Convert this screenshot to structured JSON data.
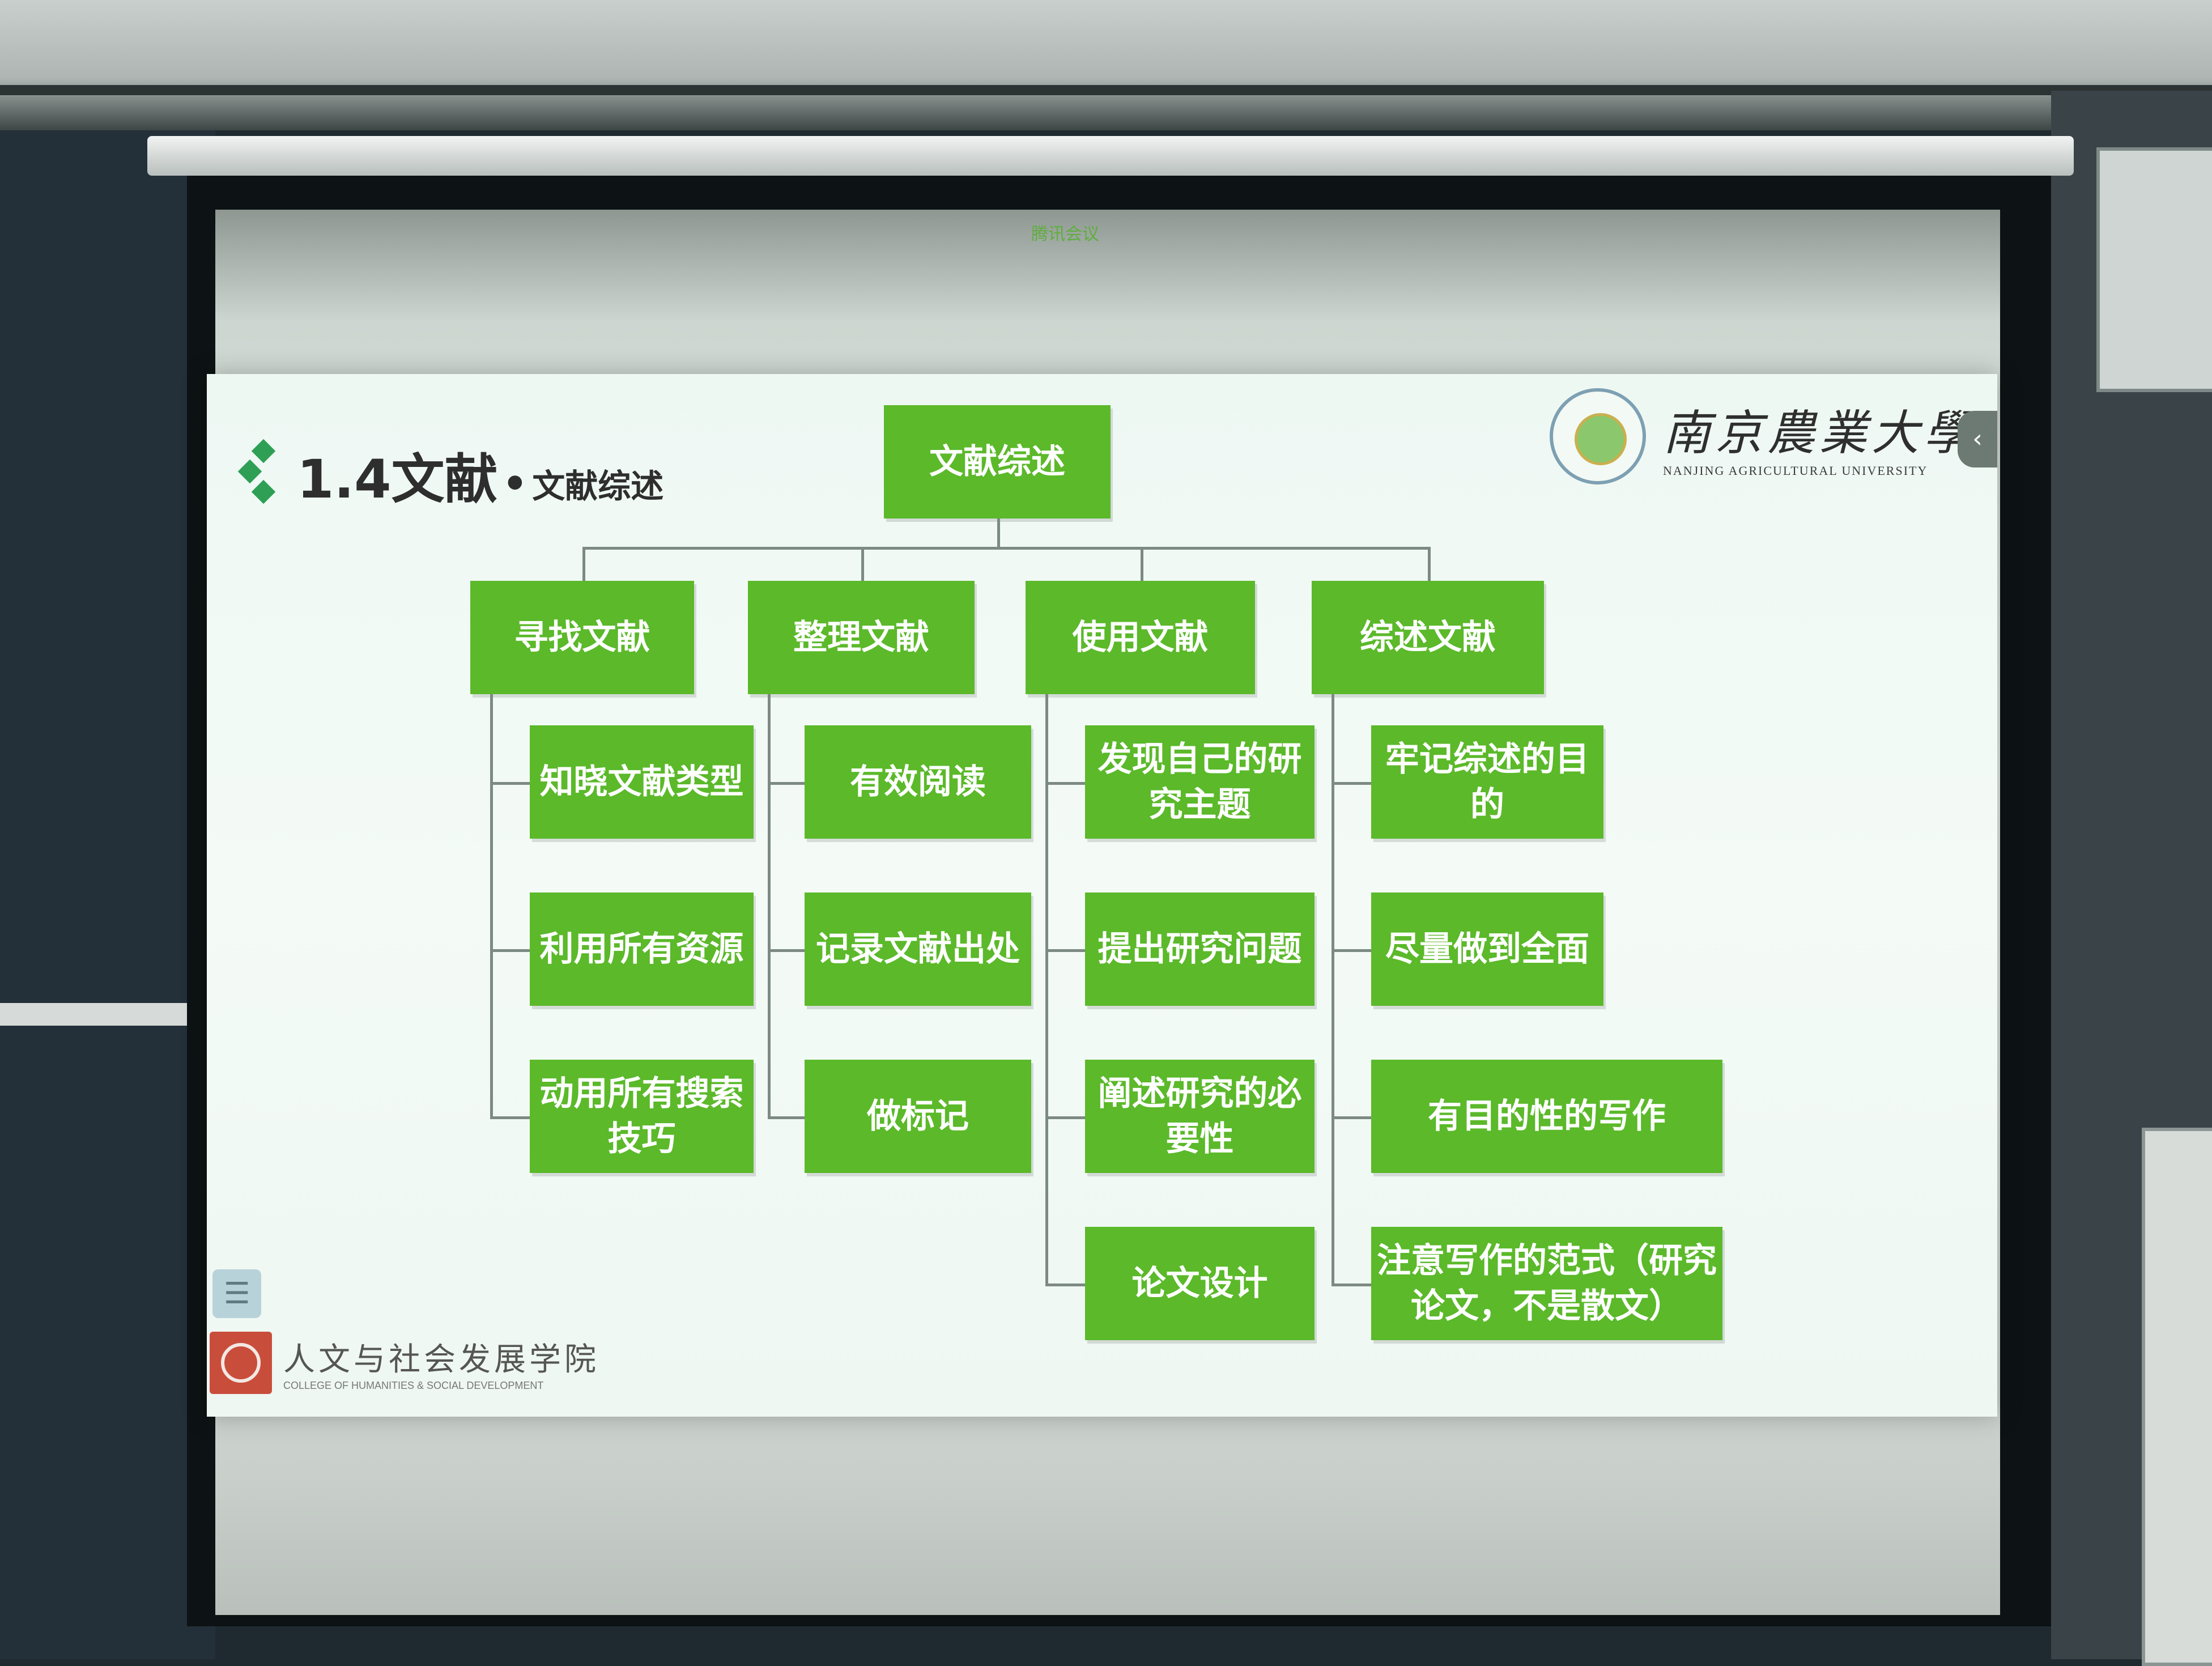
{
  "meeting_bar": {
    "label": "腾讯会议"
  },
  "slide": {
    "title_main": "1.4文献",
    "title_dot": "•",
    "title_sub": "文献综述",
    "university_cn": "南京農業大學",
    "university_en": "NANJING AGRICULTURAL UNIVERSITY",
    "college_cn": "人文与社会发展学院",
    "college_en": "COLLEGE OF HUMANITIES & SOCIAL DEVELOPMENT",
    "menu_icon": "menu-icon",
    "collapse_icon": "chevron-left-icon"
  },
  "tree": {
    "root": "文献综述",
    "branches": [
      {
        "label": "寻找文献",
        "children": [
          "知晓文献类型",
          "利用所有资源",
          "动用所有搜索技巧"
        ]
      },
      {
        "label": "整理文献",
        "children": [
          "有效阅读",
          "记录文献出处",
          "做标记"
        ]
      },
      {
        "label": "使用文献",
        "children": [
          "发现自己的研究主题",
          "提出研究问题",
          "阐述研究的必要性",
          "论文设计"
        ]
      },
      {
        "label": "综述文献",
        "children": [
          "牢记综述的目的",
          "尽量做到全面",
          "有目的性的写作",
          "注意写作的范式（研究论文，不是散文）"
        ]
      }
    ]
  },
  "colors": {
    "node": "#5bb92a",
    "node_text": "#ffffff",
    "slide_bg": "#eef8f3",
    "title_icon": "#2e9f55"
  }
}
